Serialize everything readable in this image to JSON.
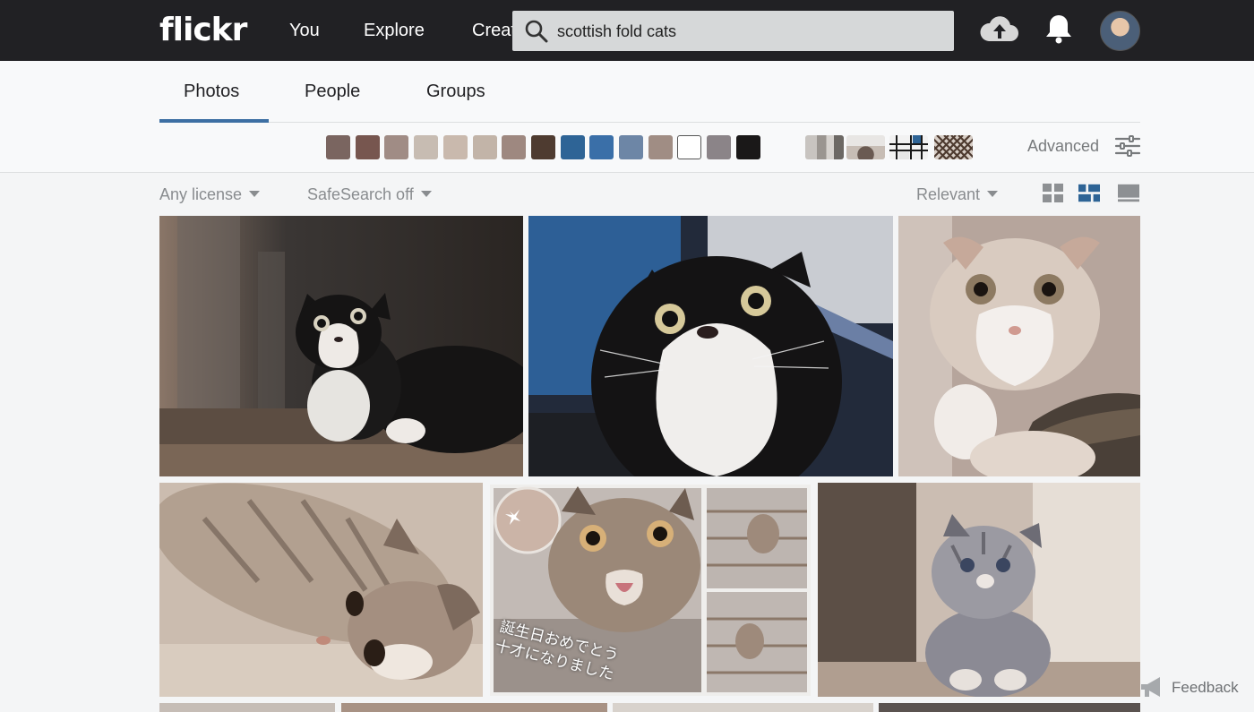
{
  "header": {
    "logo": "flickr",
    "nav": [
      "You",
      "Explore",
      "Create"
    ],
    "search": {
      "value": "scottish fold cats",
      "placeholder": ""
    },
    "icons": [
      "upload-icon",
      "bell-icon",
      "avatar"
    ]
  },
  "tabs": [
    {
      "label": "Photos",
      "active": true
    },
    {
      "label": "People",
      "active": false
    },
    {
      "label": "Groups",
      "active": false
    }
  ],
  "color_filters": [
    "#7a6560",
    "#77564f",
    "#a08c85",
    "#c7bcb2",
    "#c9b9ad",
    "#c2b4a8",
    "#9e8880",
    "#4e3b30",
    "#2e6496",
    "#3a6fa8",
    "#6d86a6",
    "#a08d84",
    "#ffffff",
    "#8b8488",
    "#1a1818"
  ],
  "style_filters": [
    "black-and-white-icon",
    "shallow-depth-icon",
    "minimalist-icon",
    "patterns-icon"
  ],
  "advanced_label": "Advanced",
  "filters": {
    "license": "Any license",
    "safesearch": "SafeSearch off",
    "sort": "Relevant"
  },
  "view_modes": [
    "grid-small-icon",
    "grid-justified-icon",
    "grid-detail-icon"
  ],
  "photos": [
    {
      "name": "tuxedo-cat-hallway"
    },
    {
      "name": "tuxedo-cat-closeup"
    },
    {
      "name": "cream-fold-kitten"
    },
    {
      "name": "tabby-lying-down"
    },
    {
      "name": "birthday-collage",
      "caption_line1": "誕生日おめでとう",
      "caption_line2": "十才になりました"
    },
    {
      "name": "tabby-kitten-sitting"
    }
  ],
  "feedback_label": "Feedback"
}
